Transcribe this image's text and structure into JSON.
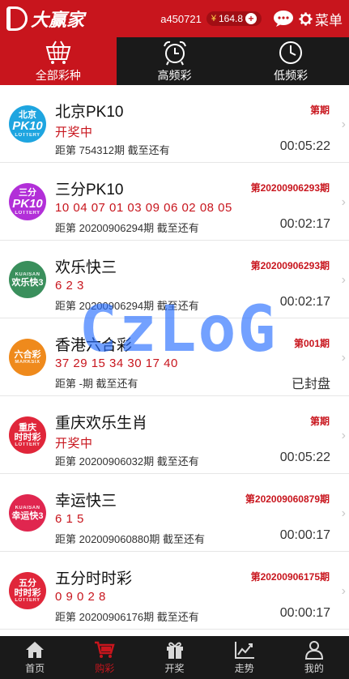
{
  "header": {
    "logo_text": "大赢家",
    "username": "a450721",
    "balance_symbol": "¥",
    "balance": "164.8",
    "add_symbol": "+",
    "menu_label": "菜单"
  },
  "tabs": [
    {
      "label": "全部彩种",
      "icon": "basket-icon",
      "active": true
    },
    {
      "label": "高频彩",
      "icon": "alarm-clock-icon",
      "active": false
    },
    {
      "label": "低频彩",
      "icon": "clock-icon",
      "active": false
    }
  ],
  "lotteries": [
    {
      "name": "北京PK10",
      "period": "第期",
      "result": "开奖中",
      "sub": "距第 754312期 截至还有",
      "countdown": "00:05:22",
      "badge": {
        "top": "北京",
        "main": "PK10",
        "sub": "LOTTERY",
        "color": "#1ea5e0"
      }
    },
    {
      "name": "三分PK10",
      "period": "第20200906293期",
      "result": "10 04 07 01 03 09 06 02 08 05",
      "sub": "距第 20200906294期 截至还有",
      "countdown": "00:02:17",
      "badge": {
        "top": "三分",
        "main": "PK10",
        "sub": "LOTTERY",
        "color": "#b22fd8"
      }
    },
    {
      "name": "欢乐快三",
      "period": "第20200906293期",
      "result": "6 2 3",
      "sub": "距第 20200906294期 截至还有",
      "countdown": "00:02:17",
      "badge": {
        "top": "KUAISAN",
        "main": "欢乐快3",
        "sub": "",
        "color": "#3a8f5c"
      }
    },
    {
      "name": "香港六合彩",
      "period": "第001期",
      "result": "37 29 15 34 30 17 40",
      "sub": "距第 -期 截至还有",
      "countdown": "已封盘",
      "badge": {
        "top": "六合彩",
        "main": "",
        "sub": "MARKSIX",
        "color": "#ef8a1c"
      }
    },
    {
      "name": "重庆欢乐生肖",
      "period": "第期",
      "result": "开奖中",
      "sub": "距第 20200906032期 截至还有",
      "countdown": "00:05:22",
      "badge": {
        "top": "重庆",
        "main": "时时彩",
        "sub": "LOTTERY",
        "color": "#e0263a"
      }
    },
    {
      "name": "幸运快三",
      "period": "第202009060879期",
      "result": "6 1 5",
      "sub": "距第 202009060880期 截至还有",
      "countdown": "00:00:17",
      "badge": {
        "top": "KUAISAN",
        "main": "幸运快3",
        "sub": "",
        "color": "#e0264f"
      }
    },
    {
      "name": "五分时时彩",
      "period": "第20200906175期",
      "result": "0 9 0 2 8",
      "sub": "距第 20200906176期 截至还有",
      "countdown": "00:00:17",
      "badge": {
        "top": "五分",
        "main": "时时彩",
        "sub": "LOTTERY",
        "color": "#e0263a"
      }
    }
  ],
  "watermark": "CzLoG",
  "chevron": "›",
  "bottom_nav": [
    {
      "label": "首页",
      "icon": "home-icon",
      "active": false
    },
    {
      "label": "购彩",
      "icon": "cart-icon",
      "active": true
    },
    {
      "label": "开奖",
      "icon": "gift-icon",
      "active": false
    },
    {
      "label": "走势",
      "icon": "trend-chart-icon",
      "active": false
    },
    {
      "label": "我的",
      "icon": "user-icon",
      "active": false
    }
  ],
  "colors": {
    "brand_red": "#c8151d",
    "dark_bar": "#1a1a1a"
  }
}
